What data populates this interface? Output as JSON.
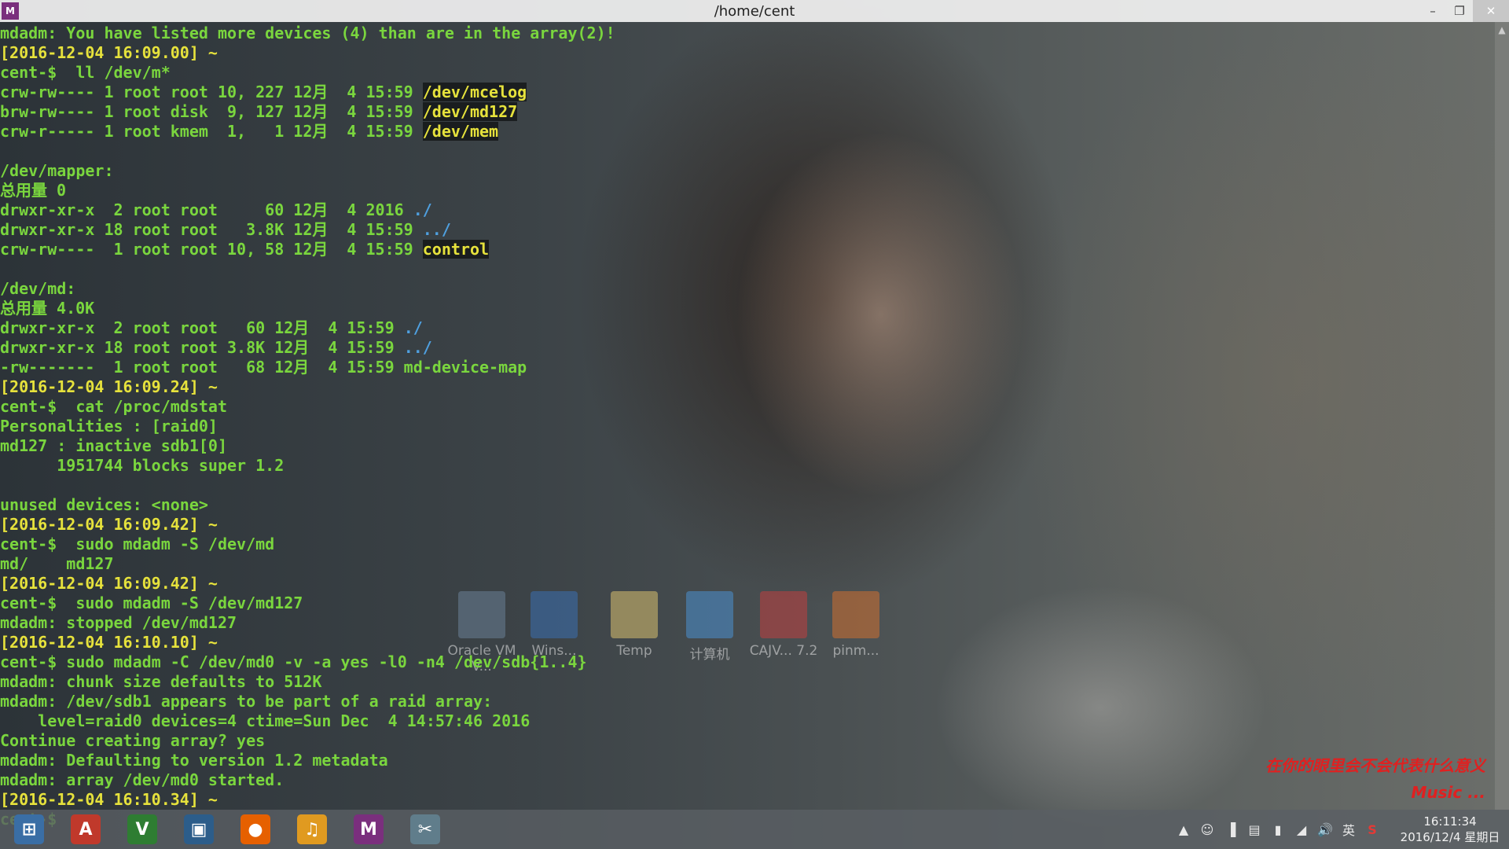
{
  "window": {
    "title": "/home/cent",
    "app_icon": "M",
    "buttons": {
      "minimize": "–",
      "maximize": "❐",
      "close": "✕"
    }
  },
  "terminal": {
    "lines": [
      [
        {
          "t": "mdadm: You have listed more devices (4) than are in the array(2)!",
          "c": "g"
        }
      ],
      [
        {
          "t": "[2016-12-04 16:09.00] ~",
          "c": "y"
        }
      ],
      [
        {
          "t": "cent-$  ll /dev/m*",
          "c": "g"
        }
      ],
      [
        {
          "t": "crw-rw---- 1 root root 10, 227 12月  4 15:59 ",
          "c": "g"
        },
        {
          "t": "/dev/mcelog",
          "c": "h"
        }
      ],
      [
        {
          "t": "brw-rw---- 1 root disk  9, 127 12月  4 15:59 ",
          "c": "g"
        },
        {
          "t": "/dev/md127",
          "c": "h"
        }
      ],
      [
        {
          "t": "crw-r----- 1 root kmem  1,   1 12月  4 15:59 ",
          "c": "g"
        },
        {
          "t": "/dev/mem",
          "c": "h"
        }
      ],
      [
        {
          "t": "",
          "c": "g"
        }
      ],
      [
        {
          "t": "/dev/mapper:",
          "c": "g"
        }
      ],
      [
        {
          "t": "总用量 0",
          "c": "g"
        }
      ],
      [
        {
          "t": "drwxr-xr-x  2 root root     60 12月  4 2016 ",
          "c": "g"
        },
        {
          "t": "./",
          "c": "b"
        }
      ],
      [
        {
          "t": "drwxr-xr-x 18 root root   3.8K 12月  4 15:59 ",
          "c": "g"
        },
        {
          "t": "../",
          "c": "b"
        }
      ],
      [
        {
          "t": "crw-rw----  1 root root 10, 58 12月  4 15:59 ",
          "c": "g"
        },
        {
          "t": "control",
          "c": "h"
        }
      ],
      [
        {
          "t": "",
          "c": "g"
        }
      ],
      [
        {
          "t": "/dev/md:",
          "c": "g"
        }
      ],
      [
        {
          "t": "总用量 4.0K",
          "c": "g"
        }
      ],
      [
        {
          "t": "drwxr-xr-x  2 root root   60 12月  4 15:59 ",
          "c": "g"
        },
        {
          "t": "./",
          "c": "b"
        }
      ],
      [
        {
          "t": "drwxr-xr-x 18 root root 3.8K 12月  4 15:59 ",
          "c": "g"
        },
        {
          "t": "../",
          "c": "b"
        }
      ],
      [
        {
          "t": "-rw-------  1 root root   68 12月  4 15:59 md-device-map",
          "c": "g"
        }
      ],
      [
        {
          "t": "[2016-12-04 16:09.24] ~",
          "c": "y"
        }
      ],
      [
        {
          "t": "cent-$  cat /proc/mdstat",
          "c": "g"
        }
      ],
      [
        {
          "t": "Personalities : [raid0]",
          "c": "g"
        }
      ],
      [
        {
          "t": "md127 : inactive sdb1[0]",
          "c": "g"
        }
      ],
      [
        {
          "t": "      1951744 blocks super 1.2",
          "c": "g"
        }
      ],
      [
        {
          "t": "",
          "c": "g"
        }
      ],
      [
        {
          "t": "unused devices: <none>",
          "c": "g"
        }
      ],
      [
        {
          "t": "[2016-12-04 16:09.42] ~",
          "c": "y"
        }
      ],
      [
        {
          "t": "cent-$  sudo mdadm -S /dev/md",
          "c": "g"
        }
      ],
      [
        {
          "t": "md/    md127",
          "c": "g"
        }
      ],
      [
        {
          "t": "[2016-12-04 16:09.42] ~",
          "c": "y"
        }
      ],
      [
        {
          "t": "cent-$  sudo mdadm -S /dev/md127",
          "c": "g"
        }
      ],
      [
        {
          "t": "mdadm: stopped /dev/md127",
          "c": "g"
        }
      ],
      [
        {
          "t": "[2016-12-04 16:10.10] ~",
          "c": "y"
        }
      ],
      [
        {
          "t": "cent-$ sudo mdadm -C /dev/md0 -v -a yes -l0 -n4 /dev/sdb{1..4}",
          "c": "g"
        }
      ],
      [
        {
          "t": "mdadm: chunk size defaults to 512K",
          "c": "g"
        }
      ],
      [
        {
          "t": "mdadm: /dev/sdb1 appears to be part of a raid array:",
          "c": "g"
        }
      ],
      [
        {
          "t": "    level=raid0 devices=4 ctime=Sun Dec  4 14:57:46 2016",
          "c": "g"
        }
      ],
      [
        {
          "t": "Continue creating array? yes",
          "c": "g"
        }
      ],
      [
        {
          "t": "mdadm: Defaulting to version 1.2 metadata",
          "c": "g"
        }
      ],
      [
        {
          "t": "mdadm: array /dev/md0 started.",
          "c": "g"
        }
      ],
      [
        {
          "t": "[2016-12-04 16:10.34] ~",
          "c": "y"
        }
      ],
      [
        {
          "t": "cent-$ ",
          "c": "g"
        }
      ]
    ]
  },
  "desktop_icons": [
    {
      "label": "Oracle VM V...",
      "color": "#6a7f95"
    },
    {
      "label": "Wins...",
      "color": "#3a6fb0"
    },
    {
      "label": "Temp",
      "color": "#d8c070"
    },
    {
      "label": "计算机",
      "color": "#4a8fd0"
    },
    {
      "label": "CAJV... 7.2",
      "color": "#c04040"
    },
    {
      "label": "pinm...",
      "color": "#d07030"
    }
  ],
  "lyrics": {
    "line1": "在你的眼里会不会代表什么意义",
    "line2": "Music ..."
  },
  "taskbar": {
    "apps": [
      {
        "name": "start-button",
        "glyph": "⊞",
        "color": "#3a6ea5"
      },
      {
        "name": "acrobat-reader",
        "glyph": "A",
        "color": "#c0392b"
      },
      {
        "name": "gvim",
        "glyph": "V",
        "color": "#2e7d32"
      },
      {
        "name": "virtualbox",
        "glyph": "▣",
        "color": "#2c5d8a"
      },
      {
        "name": "firefox",
        "glyph": "●",
        "color": "#e66000"
      },
      {
        "name": "music-player",
        "glyph": "♫",
        "color": "#e09a20"
      },
      {
        "name": "mobaxterm",
        "glyph": "M",
        "color": "#7a2f7d"
      },
      {
        "name": "snipping-tool",
        "glyph": "✂",
        "color": "#607d8b"
      }
    ],
    "tray_icons": [
      "▲",
      "☺",
      "▐",
      "▤",
      "▮",
      "◢",
      "🔊"
    ],
    "ime": "英",
    "sogou": "S",
    "clock_time": "16:11:34",
    "clock_date": "2016/12/4 星期日"
  }
}
